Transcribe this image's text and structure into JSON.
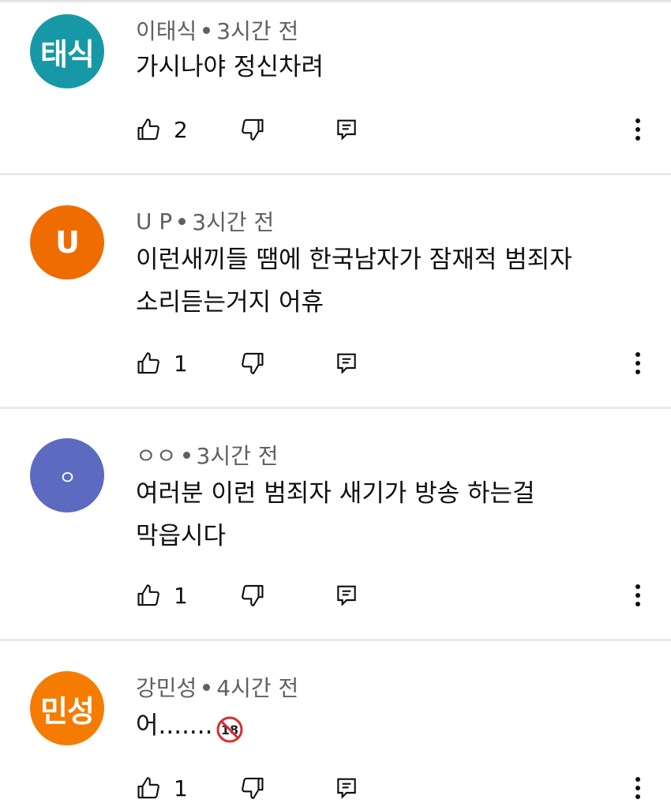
{
  "comments": [
    {
      "avatar_text": "태식",
      "avatar_color": "#1798a6",
      "author": "이태식",
      "time": "3시간 전",
      "lines": [
        "가시나야 정신차려"
      ],
      "likes": "2"
    },
    {
      "avatar_text": "U",
      "avatar_color": "#ef6c00",
      "author": "U P",
      "time": "3시간 전",
      "lines": [
        "이런새끼들 땜에 한국남자가 잠재적 범죄자",
        "소리듣는거지 어휴"
      ],
      "likes": "1"
    },
    {
      "avatar_text": "ㅇ",
      "avatar_color": "#5c6bc0",
      "author": "ㅇㅇ",
      "time": "3시간 전",
      "lines": [
        "여러분 이런 범죄자 새기가 방송 하는걸",
        "막읍시다"
      ],
      "likes": "1"
    },
    {
      "avatar_text": "민성",
      "avatar_color": "#f57c00",
      "author": "강민성",
      "time": "4시간 전",
      "lines": [
        "어......."
      ],
      "trailing_emoji": "no-under-18-icon",
      "likes": "1"
    }
  ]
}
